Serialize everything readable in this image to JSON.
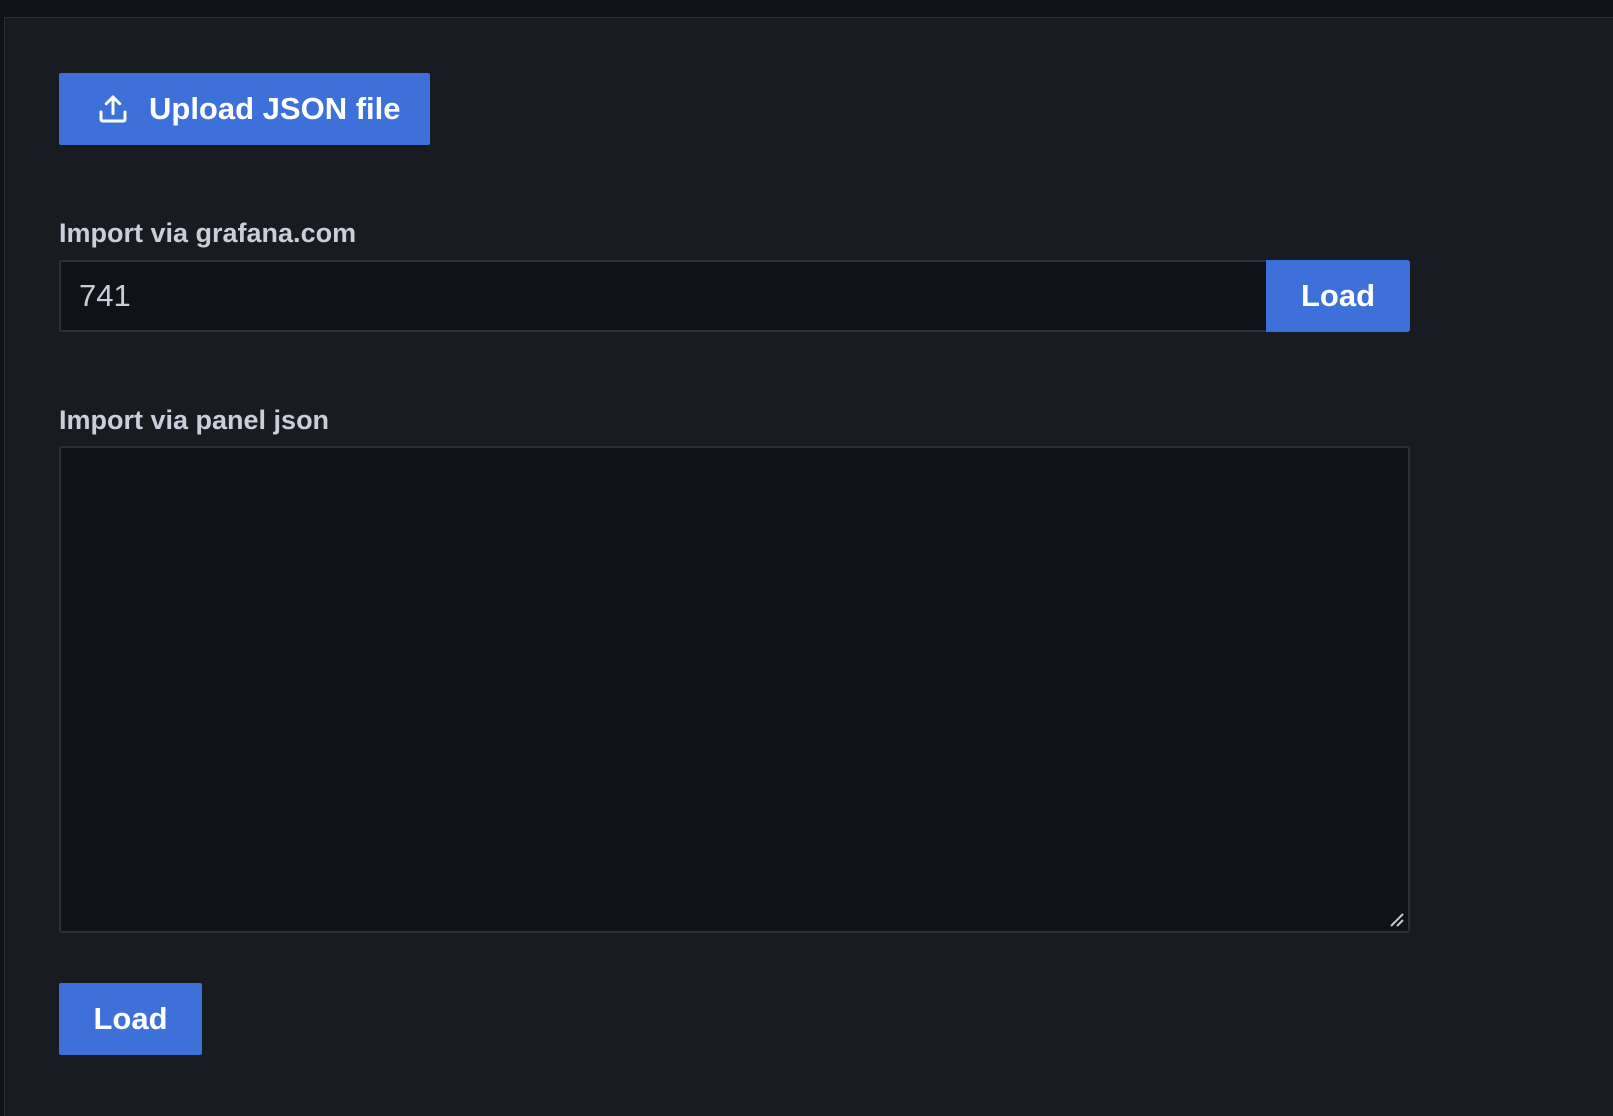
{
  "upload": {
    "label": "Upload JSON file",
    "icon": "upload-icon"
  },
  "grafana_import": {
    "label": "Import via grafana.com",
    "input_value": "741",
    "load_label": "Load"
  },
  "panel_json_import": {
    "label": "Import via panel json",
    "textarea_value": "",
    "load_label": "Load"
  },
  "colors": {
    "primary_button": "#3d71d9",
    "panel_background": "#181b1f",
    "input_background": "#111217",
    "label_text": "#ccccdc"
  }
}
